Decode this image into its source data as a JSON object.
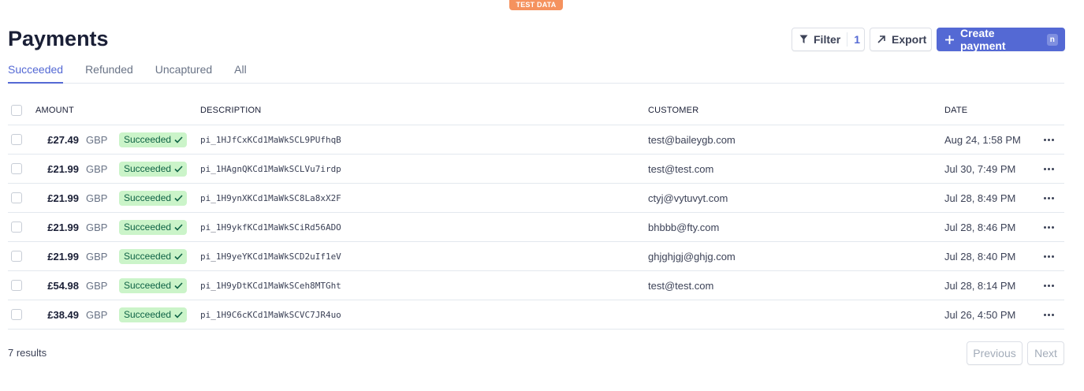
{
  "badge": "TEST DATA",
  "title": "Payments",
  "actions": {
    "filter_label": "Filter",
    "filter_count": "1",
    "export_label": "Export",
    "create_label": "Create payment",
    "create_shortcut": "n"
  },
  "tabs": [
    {
      "label": "Succeeded",
      "active": true
    },
    {
      "label": "Refunded",
      "active": false
    },
    {
      "label": "Uncaptured",
      "active": false
    },
    {
      "label": "All",
      "active": false
    }
  ],
  "columns": {
    "amount": "AMOUNT",
    "description": "DESCRIPTION",
    "customer": "CUSTOMER",
    "date": "DATE"
  },
  "rows": [
    {
      "amount": "£27.49",
      "currency": "GBP",
      "status": "Succeeded",
      "description": "pi_1HJfCxKCd1MaWkSCL9PUfhqB",
      "customer": "test@baileygb.com",
      "date": "Aug 24, 1:58 PM"
    },
    {
      "amount": "£21.99",
      "currency": "GBP",
      "status": "Succeeded",
      "description": "pi_1HAgnQKCd1MaWkSCLVu7irdp",
      "customer": "test@test.com",
      "date": "Jul 30, 7:49 PM"
    },
    {
      "amount": "£21.99",
      "currency": "GBP",
      "status": "Succeeded",
      "description": "pi_1H9ynXKCd1MaWkSC8La8xX2F",
      "customer": "ctyj@vytuvyt.com",
      "date": "Jul 28, 8:49 PM"
    },
    {
      "amount": "£21.99",
      "currency": "GBP",
      "status": "Succeeded",
      "description": "pi_1H9ykfKCd1MaWkSCiRd56ADO",
      "customer": "bhbbb@fty.com",
      "date": "Jul 28, 8:46 PM"
    },
    {
      "amount": "£21.99",
      "currency": "GBP",
      "status": "Succeeded",
      "description": "pi_1H9yeYKCd1MaWkSCD2uIf1eV",
      "customer": "ghjghjgj@ghjg.com",
      "date": "Jul 28, 8:40 PM"
    },
    {
      "amount": "£54.98",
      "currency": "GBP",
      "status": "Succeeded",
      "description": "pi_1H9yDtKCd1MaWkSCeh8MTGht",
      "customer": "test@test.com",
      "date": "Jul 28, 8:14 PM"
    },
    {
      "amount": "£38.49",
      "currency": "GBP",
      "status": "Succeeded",
      "description": "pi_1H9C6cKCd1MaWkSCVC7JR4uo",
      "customer": "",
      "date": "Jul 26, 4:50 PM"
    }
  ],
  "footer": {
    "results": "7 results",
    "previous": "Previous",
    "next": "Next"
  },
  "colors": {
    "accent": "#5469d4",
    "badge": "#f5925e",
    "success_bg": "#cbf4c9",
    "success_text": "#0e6245"
  },
  "icons": {
    "filter": "filter-icon",
    "export": "arrow-up-right-icon",
    "create": "plus-icon",
    "status": "checkmark-icon",
    "row_menu": "more-horizontal-icon"
  }
}
